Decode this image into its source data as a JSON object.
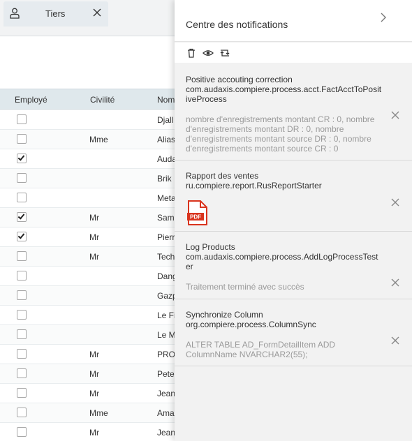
{
  "tab": {
    "label": "Tiers"
  },
  "grid": {
    "headers": {
      "employe": "Employé",
      "civilite": "Civilité",
      "nom": "Nom"
    },
    "rows": [
      {
        "checked": false,
        "civilite": "",
        "nom": "Djall"
      },
      {
        "checked": false,
        "civilite": "Mme",
        "nom": "Alias"
      },
      {
        "checked": true,
        "civilite": "",
        "nom": "Auda"
      },
      {
        "checked": false,
        "civilite": "",
        "nom": "Brik"
      },
      {
        "checked": false,
        "civilite": "",
        "nom": "Meta"
      },
      {
        "checked": true,
        "civilite": "Mr",
        "nom": "Sam"
      },
      {
        "checked": true,
        "civilite": "Mr",
        "nom": "Pierr"
      },
      {
        "checked": false,
        "civilite": "Mr",
        "nom": "Tech"
      },
      {
        "checked": false,
        "civilite": "",
        "nom": "Dang"
      },
      {
        "checked": false,
        "civilite": "",
        "nom": "Gazp"
      },
      {
        "checked": false,
        "civilite": "",
        "nom": "Le Fi"
      },
      {
        "checked": false,
        "civilite": "",
        "nom": "Le M"
      },
      {
        "checked": false,
        "civilite": "Mr",
        "nom": "PRO"
      },
      {
        "checked": false,
        "civilite": "Mr",
        "nom": "Pete"
      },
      {
        "checked": false,
        "civilite": "Mr",
        "nom": "Jean"
      },
      {
        "checked": false,
        "civilite": "Mme",
        "nom": "Ama"
      },
      {
        "checked": false,
        "civilite": "Mr",
        "nom": "Jean"
      }
    ]
  },
  "panel": {
    "title": "Centre des notifications",
    "tools": [
      "trash-icon",
      "eye-icon",
      "refresh-icon"
    ],
    "notifications": [
      {
        "title": "Positive accouting correction",
        "process": "com.audaxis.compiere.process.acct.FactAcctToPositiveProcess",
        "message": "nombre d'enregistrements montant CR : 0, nombre d'enregistrements montant DR : 0, nombre d'enregistrements montant source DR : 0, nombre d'enregistrements montant source CR : 0"
      },
      {
        "title": "Rapport des ventes",
        "process": "ru.compiere.report.RusReportStarter",
        "attachment": "PDF"
      },
      {
        "title": "Log Products",
        "process": "com.audaxis.compiere.process.AddLogProcessTester",
        "message": "Traitement terminé avec succès"
      },
      {
        "title": "Synchronize Column",
        "process": "org.compiere.process.ColumnSync",
        "message": "ALTER TABLE AD_FormDetailItem ADD ColumnName NVARCHAR2(55);"
      }
    ]
  },
  "colors": {
    "pdf_red": "#d9341e",
    "panel_bg": "#f2f2f2",
    "header_bg": "#dfe8ec"
  }
}
